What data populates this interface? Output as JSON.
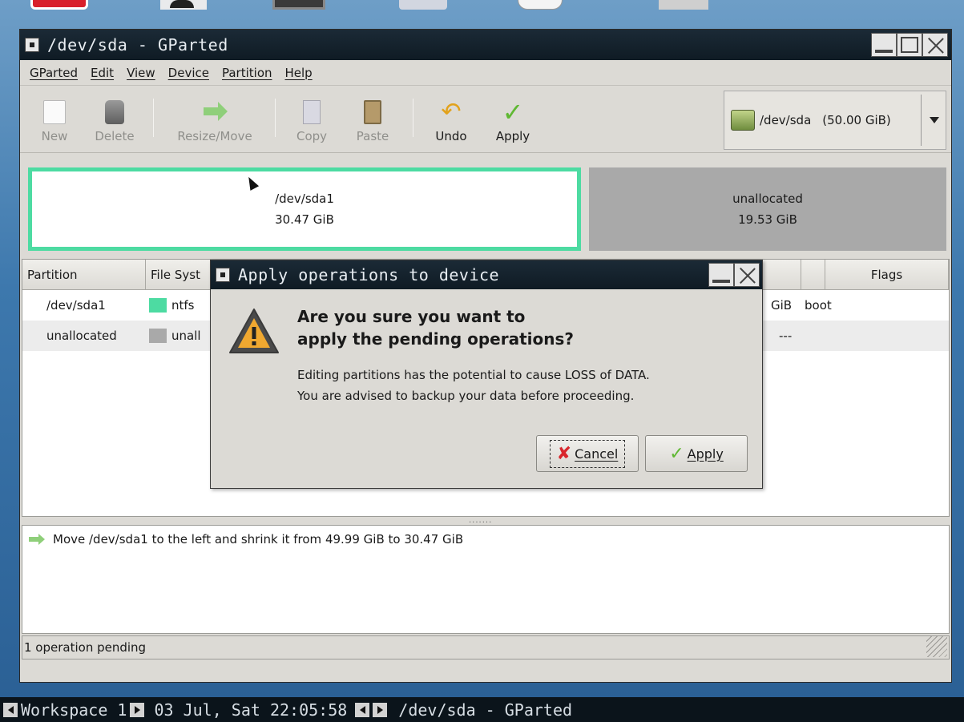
{
  "main_window": {
    "title": "/dev/sda - GParted",
    "menu": [
      "GParted",
      "Edit",
      "View",
      "Device",
      "Partition",
      "Help"
    ],
    "toolbar": {
      "new": "New",
      "delete": "Delete",
      "resize_move": "Resize/Move",
      "copy": "Copy",
      "paste": "Paste",
      "undo": "Undo",
      "apply": "Apply"
    },
    "device_selector": {
      "device": "/dev/sda",
      "size": "(50.00 GiB)"
    }
  },
  "partition_map": {
    "sda1": {
      "name": "/dev/sda1",
      "size": "30.47 GiB",
      "fraction": 0.6094
    },
    "unallocated": {
      "name": "unallocated",
      "size": "19.53 GiB",
      "fraction": 0.3906
    }
  },
  "partition_list": {
    "headers": {
      "partition": "Partition",
      "filesystem": "File Syst",
      "flags": "Flags"
    },
    "rows": [
      {
        "partition": "/dev/sda1",
        "filesystem": "ntfs",
        "size_tail": "GiB",
        "flags": "boot",
        "color": "#4ddba2"
      },
      {
        "partition": "unallocated",
        "filesystem": "unall",
        "size_tail": "---",
        "flags": "",
        "color": "#a9a9a9"
      }
    ]
  },
  "operations": {
    "items": [
      "Move /dev/sda1 to the left and shrink it from 49.99 GiB to 30.47 GiB"
    ],
    "status": "1 operation pending"
  },
  "dialog": {
    "title": "Apply operations to device",
    "heading_line1": "Are you sure you want to",
    "heading_line2": "apply the pending operations?",
    "body_line1": "Editing partitions has the potential to cause LOSS of DATA.",
    "body_line2": "You are advised to backup your data before proceeding.",
    "cancel_label": "Cancel",
    "apply_label": "Apply"
  },
  "taskbar": {
    "workspace": "Workspace 1",
    "datetime": "03 Jul, Sat 22:05:58",
    "task": "/dev/sda - GParted"
  },
  "colors": {
    "ntfs": "#4ddba2",
    "unallocated": "#a9a9a9",
    "titlebar": "#0f1b24"
  }
}
